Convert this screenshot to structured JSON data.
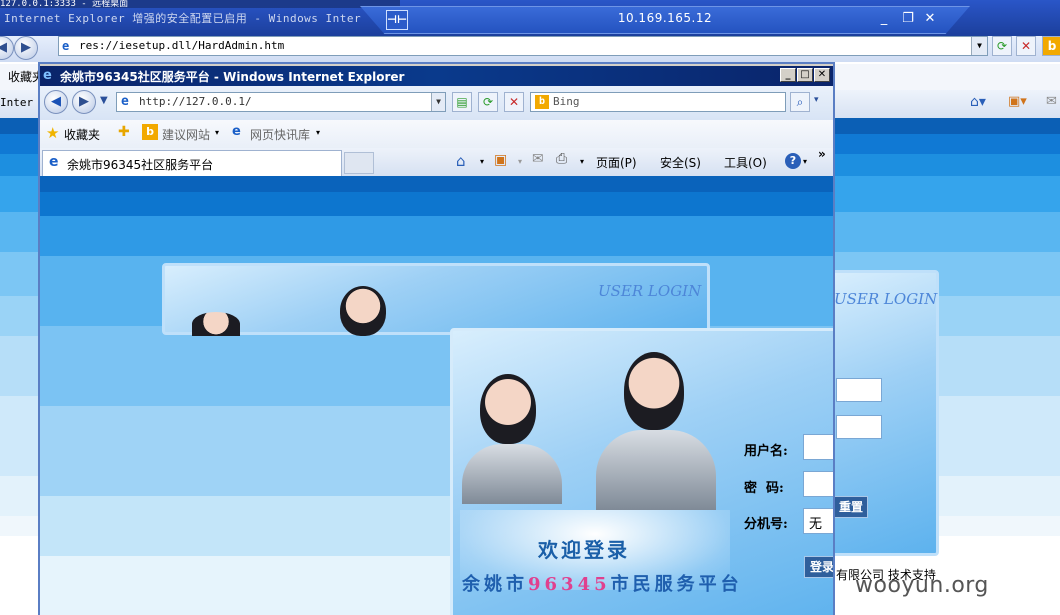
{
  "outer": {
    "top_crop_text": "127.0.0.1:3333 - 远程桌面",
    "title": "Internet Explorer 增强的安全配置已启用 - Windows Inter",
    "address": "res://iesetup.dll/HardAdmin.htm",
    "fav_label": "收藏夹",
    "tab_label": "Inter",
    "user_login": "USER LOGIN",
    "reset_button": "重置",
    "support_text": "有限公司 技术支持"
  },
  "rdp": {
    "ip": "10.169.165.12",
    "pin_glyph": "⊣⊢",
    "min_glyph": "_",
    "restore_glyph": "❐",
    "close_glyph": "✕"
  },
  "window": {
    "title": "余姚市96345社区服务平台 - Windows Internet Explorer",
    "address": "http://127.0.0.1/",
    "search_placeholder": "Bing",
    "fav_label": "收藏夹",
    "suggested_sites": "建议网站",
    "web_slice": "网页快讯库",
    "tab_title": "余姚市96345社区服务平台",
    "cmd_page": "页面(P)",
    "cmd_safety": "安全(S)",
    "cmd_tools": "工具(O)",
    "chevron": "»"
  },
  "login": {
    "user_login": "USER LOGIN",
    "username_label": "用户名:",
    "password_label": "密  码:",
    "extension_label": "分机号:",
    "extension_value": "无",
    "login_button": "登录",
    "welcome": "欢迎登录",
    "platform_prefix": "余姚市",
    "platform_number": "96345",
    "platform_suffix": "市民服务平台"
  },
  "watermark": "wooyun.org",
  "icons": [
    "ie-icon",
    "back-icon",
    "forward-icon",
    "refresh-icon",
    "stop-icon",
    "search-icon",
    "star-icon",
    "home-icon",
    "rss-icon",
    "mail-icon",
    "print-icon",
    "help-icon"
  ],
  "colors": {
    "titlebar": "#0a246a",
    "page_blue": "#0a6cc8",
    "accent_pink": "#e0408e"
  }
}
